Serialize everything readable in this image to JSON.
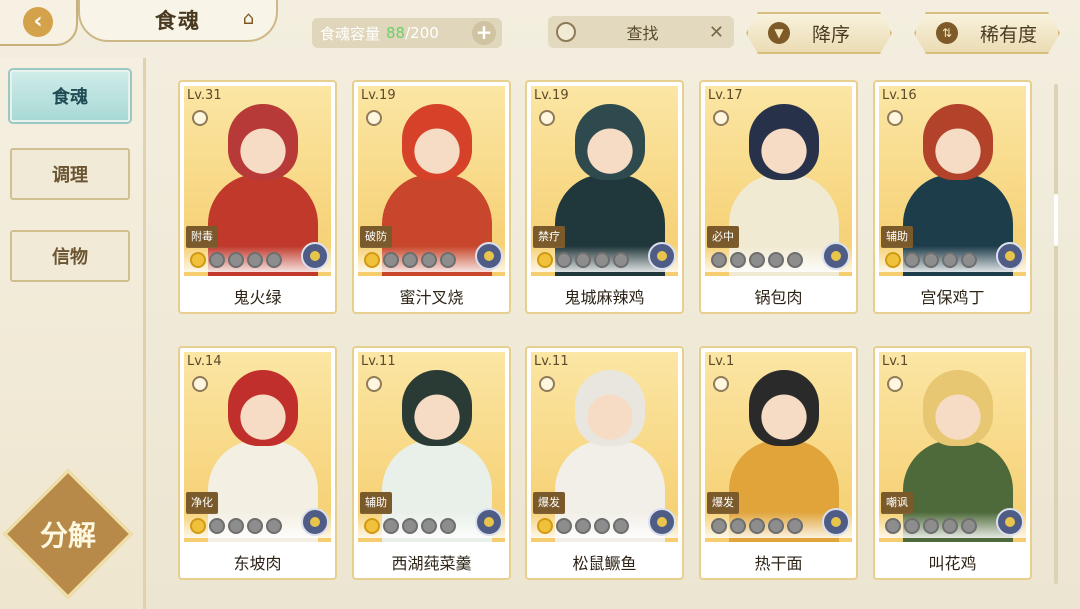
{
  "header": {
    "back_icon": "chevron-left-icon",
    "title": "食魂",
    "title_icon": "pavilion-icon",
    "capacity_label": "食魂容量",
    "capacity_current": "88",
    "capacity_max": "/200",
    "add_icon": "plus-icon",
    "search_label": "查找",
    "search_icon": "search-icon",
    "clear_icon": "close-icon",
    "sort_order_label": "降序",
    "sort_key_label": "稀有度"
  },
  "sidebar": {
    "items": [
      {
        "label": "食魂",
        "active": true
      },
      {
        "label": "调理",
        "active": false
      },
      {
        "label": "信物",
        "active": false
      }
    ],
    "decompose_label": "分解"
  },
  "cards": [
    {
      "level": "Lv.31",
      "tag": "附毒",
      "name": "鬼火绿",
      "stars": 1,
      "hair": "#b73a39",
      "outfit": "#c0392b"
    },
    {
      "level": "Lv.19",
      "tag": "破防",
      "name": "蜜汁叉烧",
      "stars": 1,
      "hair": "#d6412a",
      "outfit": "#c8462b"
    },
    {
      "level": "Lv.19",
      "tag": "禁疗",
      "name": "鬼城麻辣鸡",
      "stars": 1,
      "hair": "#2f4a4e",
      "outfit": "#20373b"
    },
    {
      "level": "Lv.17",
      "tag": "必中",
      "name": "锅包肉",
      "stars": 0,
      "hair": "#27314a",
      "outfit": "#f1ead2"
    },
    {
      "level": "Lv.16",
      "tag": "辅助",
      "name": "宫保鸡丁",
      "stars": 1,
      "hair": "#b2432a",
      "outfit": "#1e3d4b"
    },
    {
      "level": "Lv.14",
      "tag": "净化",
      "name": "东坡肉",
      "stars": 1,
      "hair": "#c02f2b",
      "outfit": "#f4efe3"
    },
    {
      "level": "Lv.11",
      "tag": "辅助",
      "name": "西湖莼菜羹",
      "stars": 1,
      "hair": "#2a3b36",
      "outfit": "#e9f0e9"
    },
    {
      "level": "Lv.11",
      "tag": "爆发",
      "name": "松鼠鳜鱼",
      "stars": 1,
      "hair": "#e9e6df",
      "outfit": "#f2efe8"
    },
    {
      "level": "Lv.1",
      "tag": "爆发",
      "name": "热干面",
      "stars": 0,
      "hair": "#2a2a2a",
      "outfit": "#e1a43a"
    },
    {
      "level": "Lv.1",
      "tag": "嘲讽",
      "name": "叫花鸡",
      "stars": 0,
      "hair": "#e8c773",
      "outfit": "#4e6a3a"
    }
  ]
}
